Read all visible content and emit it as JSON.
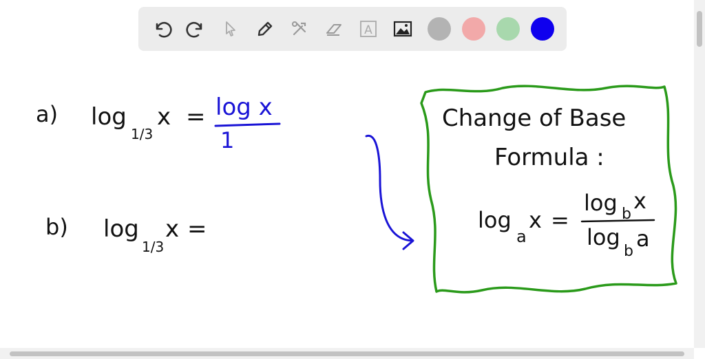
{
  "toolbar": {
    "tools": [
      {
        "name": "undo"
      },
      {
        "name": "redo"
      },
      {
        "name": "select"
      },
      {
        "name": "pen"
      },
      {
        "name": "tools"
      },
      {
        "name": "eraser"
      },
      {
        "name": "text",
        "label": "A"
      },
      {
        "name": "image"
      }
    ],
    "colors": [
      "#b3b3b3",
      "#f2a9a9",
      "#a8d8ad",
      "#0f00ee"
    ]
  },
  "whiteboard": {
    "part_a": {
      "label": "a)",
      "lhs": "log",
      "base": "1/3",
      "var": "x",
      "equals": "=",
      "numerator": "log x",
      "denominator": "1"
    },
    "part_b": {
      "label": "b)",
      "lhs": "log",
      "base": "1/3",
      "var": "x",
      "equals": "="
    },
    "box": {
      "title_line1": "Change of Base",
      "title_line2": "Formula :",
      "formula_lhs": "log",
      "formula_lhs_sub": "a",
      "formula_var": "x",
      "equals": "=",
      "numerator": "log",
      "numerator_sub": "b",
      "numerator_var": "x",
      "denominator": "log",
      "denominator_sub": "b",
      "denominator_var": "a"
    },
    "ink_colors": {
      "black": "#111111",
      "blue": "#1a14d6",
      "green": "#2a9a1a"
    }
  }
}
